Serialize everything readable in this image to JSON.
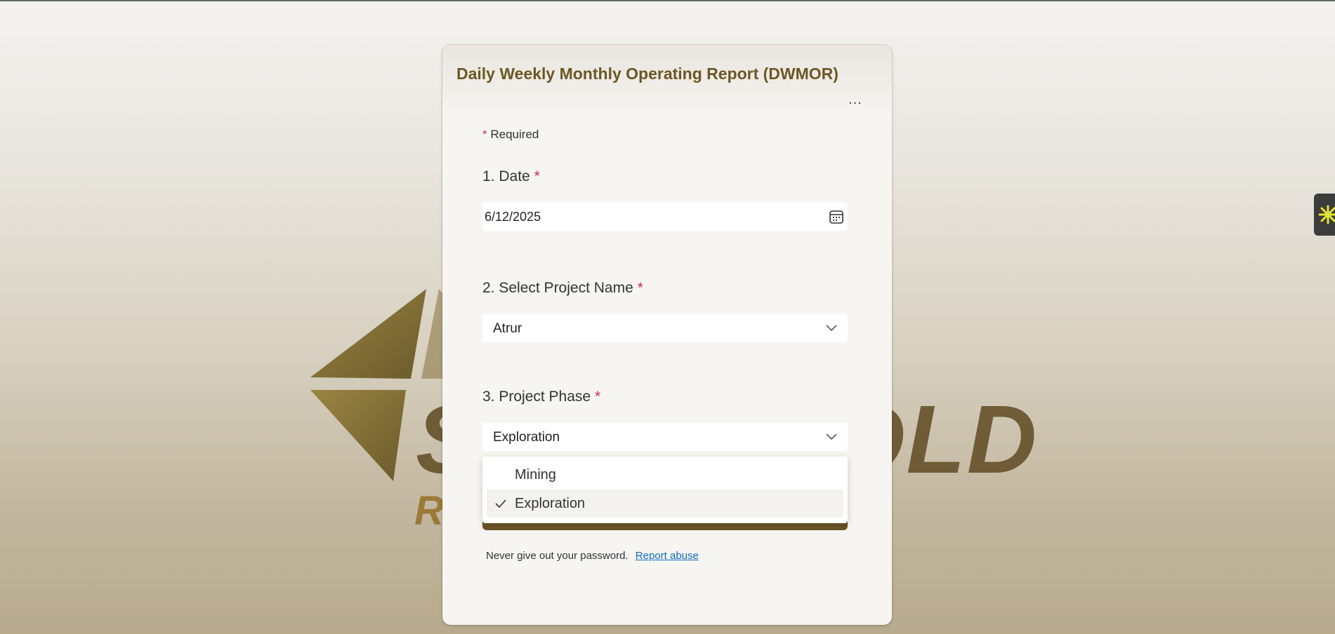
{
  "form": {
    "title": "Daily Weekly Monthly Operating Report (DWMOR)",
    "more_label": "...",
    "required_star": "*",
    "required_text": "Required"
  },
  "questions": [
    {
      "number": "1.",
      "label": "Date",
      "value": "6/12/2025",
      "type": "date"
    },
    {
      "number": "2.",
      "label": "Select Project Name",
      "value": "Atrur",
      "type": "dropdown"
    },
    {
      "number": "3.",
      "label": "Project Phase",
      "value": "Exploration",
      "type": "dropdown",
      "options": [
        {
          "label": "Mining",
          "selected": false
        },
        {
          "label": "Exploration",
          "selected": true
        }
      ]
    }
  ],
  "footer": {
    "notice": "Never give out your password.",
    "report_link": "Report abuse"
  },
  "background": {
    "brand_word": "SAUDI GOLD",
    "brand_sub": "RE"
  },
  "colors": {
    "title": "#6d5724",
    "required_star": "#c4314b",
    "accent_bar": "#6b5526",
    "link": "#0f6cbd"
  },
  "icons": {
    "date": "calendar-icon",
    "dropdown": "chevron-down-icon",
    "selected": "checkmark-icon"
  }
}
